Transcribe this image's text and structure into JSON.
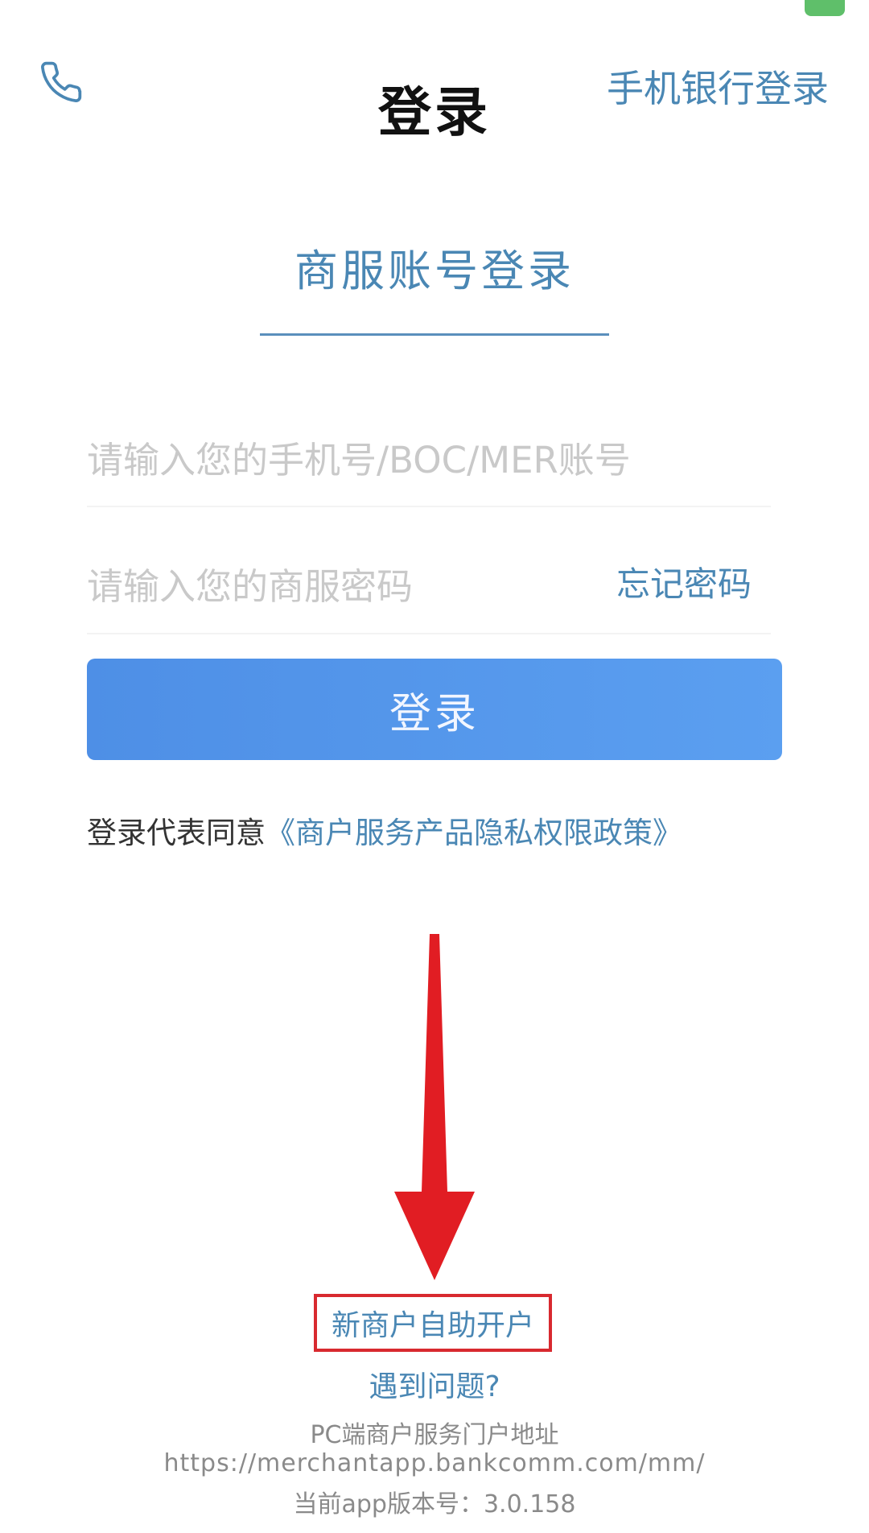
{
  "header": {
    "title": "登录",
    "mobile_bank_login": "手机银行登录",
    "phone_icon": "phone-icon"
  },
  "tab": {
    "label": "商服账号登录"
  },
  "form": {
    "account_placeholder": "请输入您的手机号/BOC/MER账号",
    "password_placeholder": "请输入您的商服密码",
    "forgot_password": "忘记密码",
    "login_button": "登录"
  },
  "consent": {
    "prefix": "登录代表同意",
    "policy_link": "《商户服务产品隐私权限政策》"
  },
  "annotation": {
    "arrow_color": "#e11d23",
    "box_color": "#d8292f"
  },
  "bottom": {
    "new_merchant": "新商户自助开户",
    "help": "遇到问题?",
    "pc_portal_label": "PC端商户服务门户地址",
    "pc_portal_url": "https://merchantapp.bankcomm.com/mm/",
    "version": "当前app版本号：3.0.158"
  },
  "colors": {
    "accent": "#4a87b4",
    "button": "#5596ec"
  }
}
